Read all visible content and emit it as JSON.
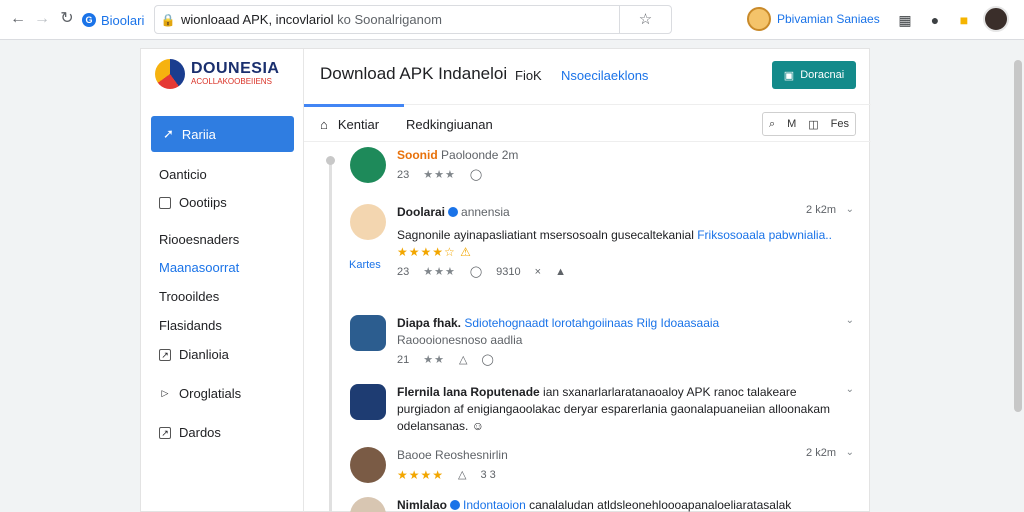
{
  "browser": {
    "site_chip": "Bioolari",
    "url_main": "wionloaad APK, incovlariol",
    "url_dim": "ko Soonalriganom",
    "profile_name": "Pbivamian Saniaes",
    "icons": [
      "grid-icon",
      "extensions-icon",
      "notifications-icon",
      "account-avatar"
    ]
  },
  "sidebar": {
    "logo_title": "DOUNESIA",
    "logo_sub": "ACOLLAKOOBEIIENS",
    "home_button": "Rariia",
    "items": [
      {
        "label": "Oanticio"
      },
      {
        "label": "Oootiips"
      },
      {
        "label": "Riooesnaders"
      },
      {
        "label": "Maanasoorrat"
      },
      {
        "label": "Troooildes"
      },
      {
        "label": "Flasidands"
      },
      {
        "label": "Dianlioia"
      },
      {
        "label": "Oroglatials"
      },
      {
        "label": "Dardos"
      }
    ]
  },
  "header": {
    "title": "Download APK Indaneloi",
    "link1": "FioK",
    "link2": "Nsoecilaeklons",
    "download_button": "Doracnai"
  },
  "tabs": {
    "tab1": "Kentiar",
    "tab2": "Redkingiuanan",
    "tool1": "M",
    "tool2": "Fes"
  },
  "side_label": "Kartes",
  "posts": [
    {
      "name": "Soonid",
      "sub": "Paoloonde 2m",
      "meta_count": "23",
      "time": "",
      "text": "",
      "link": ""
    },
    {
      "name": "Doolarai",
      "sub": "annensia",
      "time": "2 k2m",
      "text": "Sagnonile ayinapasliatiant msersosoaln gusecaltekanial",
      "link": "Friksosoaala pabwnialia..",
      "meta_count": "23",
      "meta_extra": "9310"
    },
    {
      "name": "Diapa fhak.",
      "link": "Sdiotehognaadt lorotahgoiinaas Rilg Idoaasaaia",
      "sub": "Raoooionesnoso aadlia",
      "meta_count": "21",
      "time": ""
    },
    {
      "name": "Flernila lana Roputenade",
      "text": "ian sxanarlarlaratanaoaloy APK ranoc talakeare purgiadon af enigiangaoolakac deryar esparerlania gaonalapuaneiian alloonakam",
      "text2": "odelansanas.",
      "time": ""
    },
    {
      "name": "Baooe Reoshesnirlin",
      "sub": "",
      "meta_count": "3 3",
      "time": "2 k2m"
    },
    {
      "name": "Nimlalao",
      "link": "Indontaoion",
      "text": "canalaludan atldsleonehloooapanaloeliaratasalak",
      "time": ""
    }
  ]
}
